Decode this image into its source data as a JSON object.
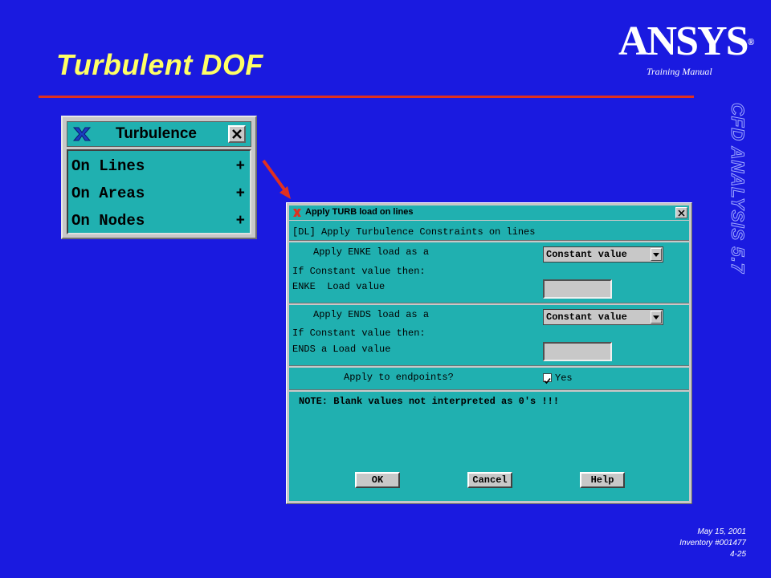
{
  "slide": {
    "title": "Turbulent  DOF",
    "logo": "ANSYS",
    "logo_mark": "®",
    "subtitle": "Training Manual",
    "side_label": "CFD ANALYSIS 5.7",
    "footer": {
      "date": "May 15, 2001",
      "inventory": "Inventory #001477",
      "page": "4-25"
    }
  },
  "menu": {
    "title": "Turbulence",
    "icon": "x-logo-icon",
    "items": [
      {
        "label": "On Lines",
        "suffix": "+"
      },
      {
        "label": "On Areas",
        "suffix": "+"
      },
      {
        "label": "On Nodes",
        "suffix": "+"
      }
    ]
  },
  "dialog": {
    "title": "Apply TURB load on lines",
    "header": "[DL] Apply Turbulence Constraints on lines",
    "enke": {
      "apply_label": "Apply ENKE load as a",
      "selected": "Constant value",
      "if_label": "If Constant value then:",
      "value_label": "ENKE  Load value",
      "value": ""
    },
    "ends": {
      "apply_label": "Apply ENDS load as a",
      "selected": "Constant value",
      "if_label": "If Constant value then:",
      "value_label": "ENDS a Load value",
      "value": ""
    },
    "endpoints": {
      "label": "Apply to endpoints?",
      "checkbox_label": "Yes",
      "checked": true
    },
    "note": "NOTE: Blank values not interpreted as 0's !!!",
    "buttons": {
      "ok": "OK",
      "cancel": "Cancel",
      "help": "Help"
    }
  },
  "colors": {
    "background": "#1a1ae0",
    "title": "#ffff66",
    "rule": "#e03020",
    "panel": "#20b0b0",
    "arrow": "#e03020"
  }
}
